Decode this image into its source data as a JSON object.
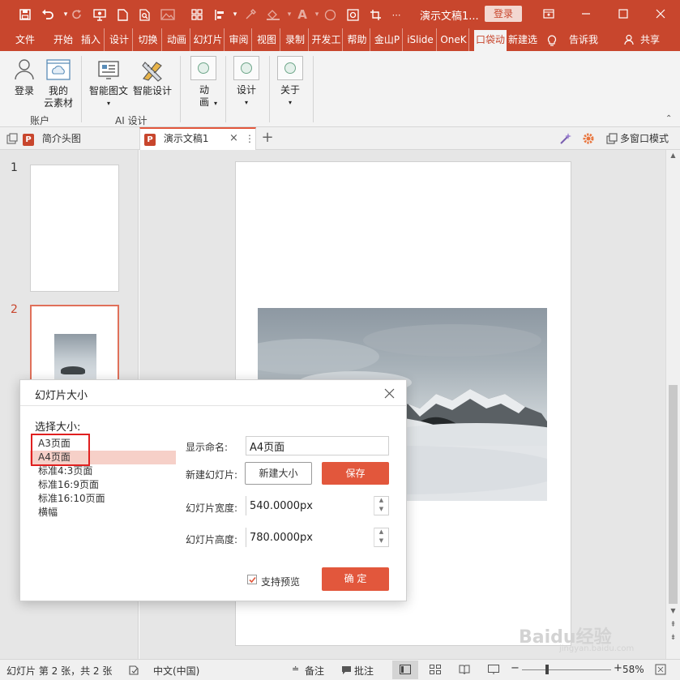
{
  "titlebar": {
    "doc_title": "演示文稿1...",
    "login_label": "登录"
  },
  "ribbon_tabs": [
    "文件",
    "开始",
    "插入",
    "设计",
    "切换",
    "动画",
    "幻灯片",
    "审阅",
    "视图",
    "录制",
    "开发工",
    "帮助",
    "金山P",
    "iSlide",
    "OneK",
    "口袋动",
    "新建选"
  ],
  "ribbon_tab_active": "口袋动",
  "tell_me": "告诉我",
  "share": "共享",
  "ribbon": {
    "login": "登录",
    "my_cloud_1": "我的",
    "my_cloud_2": "云素材",
    "group_account": "账户",
    "smart_graphic": "智能图文",
    "smart_design": "智能设计",
    "group_ai": "AI 设计",
    "anim_1": "动",
    "anim_2": "画",
    "design": "设计",
    "about": "关于"
  },
  "doc_tabs": {
    "tab1": "简介头图",
    "tab2": "演示文稿1",
    "multi_window": "多窗口模式"
  },
  "slides": {
    "slide1_num": "1",
    "slide2_num": "2"
  },
  "dialog": {
    "title": "幻灯片大小",
    "select_size_label": "选择大小:",
    "size_options": [
      "A3页面",
      "A4页面",
      "标准4:3页面",
      "标准16:9页面",
      "标准16:10页面",
      "横幅"
    ],
    "selected_option": "A4页面",
    "display_name_label": "显示命名:",
    "display_name_value": "A4页面",
    "new_slide_label": "新建幻灯片:",
    "new_size_button": "新建大小",
    "save_button": "保存",
    "width_label": "幻灯片宽度:",
    "width_value": "540.0000px",
    "height_label": "幻灯片高度:",
    "height_value": "780.0000px",
    "preview_label": "支持预览",
    "preview_checked": true,
    "ok_button": "确 定"
  },
  "statusbar": {
    "slide_info": "幻灯片 第 2 张，共 2 张",
    "language": "中文(中国)",
    "notes": "备注",
    "comments": "批注",
    "zoom": "58%"
  },
  "watermark": "Baidu经验 jingyan.baidu.com",
  "colors": {
    "accent": "#c8462d",
    "button_red": "#e2573c"
  }
}
